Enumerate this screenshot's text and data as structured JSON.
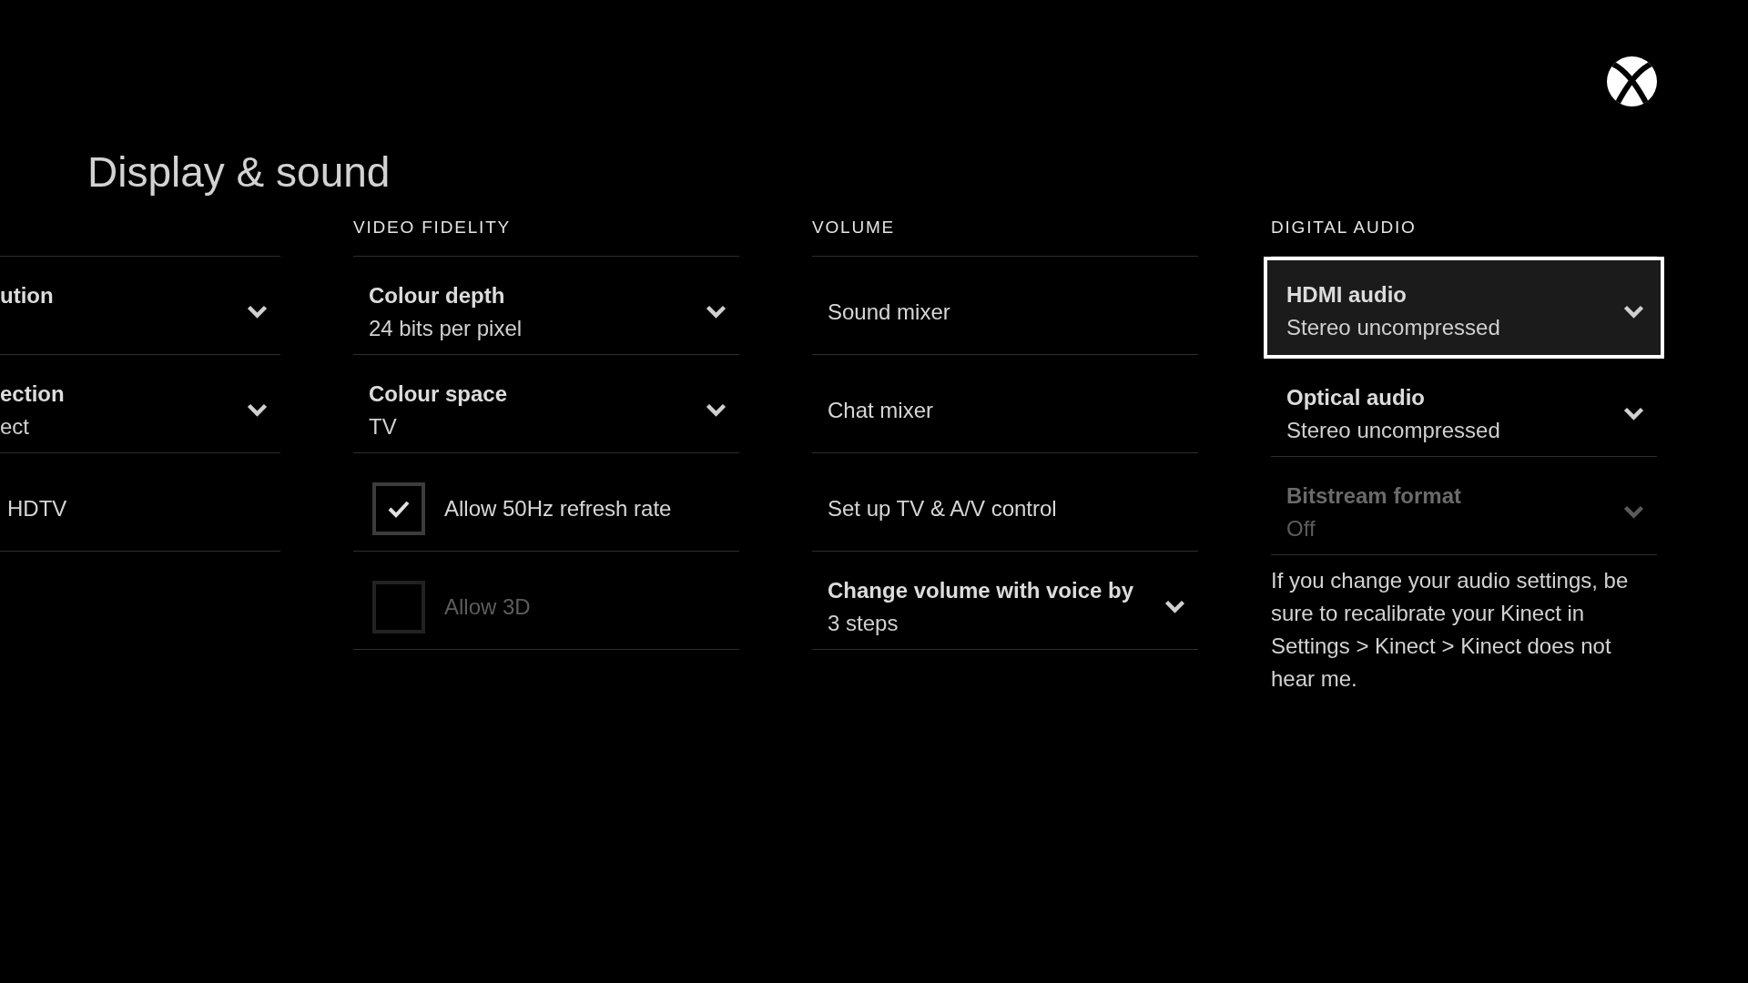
{
  "header": {
    "title": "Display & sound"
  },
  "columns": [
    {
      "rows": [
        {
          "kind": "dropdown",
          "label": "ution",
          "selected": false,
          "disabled": false
        },
        {
          "kind": "dropdown",
          "label": "ection",
          "value": "ect",
          "selected": false,
          "disabled": false
        },
        {
          "kind": "link",
          "label": "HDTV",
          "selected": false,
          "disabled": false
        }
      ]
    },
    {
      "title": "VIDEO FIDELITY",
      "rows": [
        {
          "kind": "dropdown",
          "label": "Colour depth",
          "value": "24 bits per pixel",
          "selected": false,
          "disabled": false
        },
        {
          "kind": "dropdown",
          "label": "Colour space",
          "value": "TV",
          "selected": false,
          "disabled": false
        },
        {
          "kind": "checkbox",
          "label": "Allow 50Hz refresh rate",
          "checked": true,
          "selected": false,
          "disabled": false
        },
        {
          "kind": "checkbox",
          "label": "Allow 3D",
          "checked": false,
          "selected": false,
          "disabled": true
        }
      ]
    },
    {
      "title": "VOLUME",
      "rows": [
        {
          "kind": "link",
          "label": "Sound mixer",
          "selected": false,
          "disabled": false
        },
        {
          "kind": "link",
          "label": "Chat mixer",
          "selected": false,
          "disabled": false
        },
        {
          "kind": "link",
          "label": "Set up TV & A/V control",
          "selected": false,
          "disabled": false
        },
        {
          "kind": "dropdown",
          "label": "Change volume with voice by",
          "value": "3 steps",
          "selected": false,
          "disabled": false
        }
      ]
    },
    {
      "title": "DIGITAL AUDIO",
      "rows": [
        {
          "kind": "dropdown",
          "label": "HDMI audio",
          "value": "Stereo uncompressed",
          "selected": true,
          "disabled": false
        },
        {
          "kind": "dropdown",
          "label": "Optical audio",
          "value": "Stereo uncompressed",
          "selected": false,
          "disabled": false
        },
        {
          "kind": "dropdown",
          "label": "Bitstream format",
          "value": "Off",
          "selected": false,
          "disabled": true
        }
      ],
      "note": "If you change your audio settings, be sure to recalibrate your Kinect in Settings > Kinect > Kinect does not hear me."
    }
  ]
}
